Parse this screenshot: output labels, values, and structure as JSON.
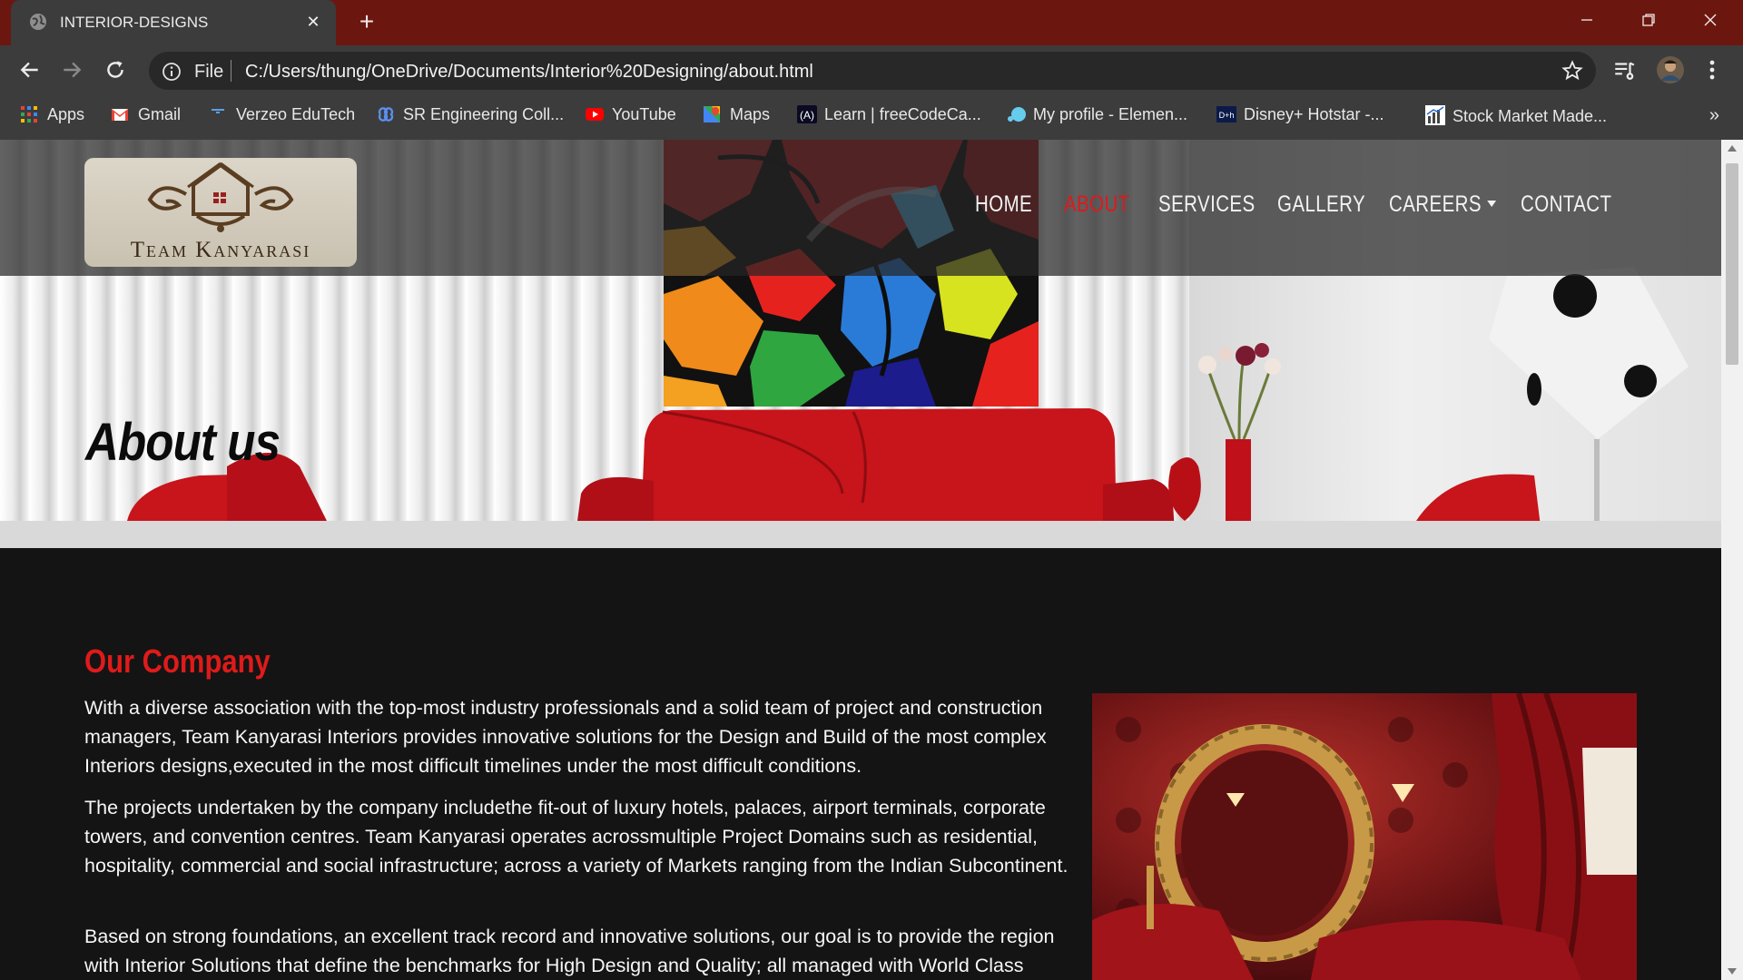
{
  "browser": {
    "tab_title": "INTERIOR-DESIGNS",
    "url_scheme": "File",
    "url": "C:/Users/thung/OneDrive/Documents/Interior%20Designing/about.html",
    "bookmarks": [
      {
        "label": "Apps",
        "icon": "apps-grid-icon"
      },
      {
        "label": "Gmail",
        "icon": "gmail-icon"
      },
      {
        "label": "Verzeo EduTech",
        "icon": "verzeo-icon"
      },
      {
        "label": "SR Engineering Coll...",
        "icon": "sr-engineering-icon"
      },
      {
        "label": "YouTube",
        "icon": "youtube-icon"
      },
      {
        "label": "Maps",
        "icon": "maps-icon"
      },
      {
        "label": "Learn | freeCodeCa...",
        "icon": "freecodecamp-icon"
      },
      {
        "label": "My profile - Elemen...",
        "icon": "elementor-icon"
      },
      {
        "label": "Disney+ Hotstar -...",
        "icon": "hotstar-icon"
      },
      {
        "label": "Stock Market Made...",
        "icon": "stock-market-icon"
      }
    ],
    "bookmarks_overflow": "»"
  },
  "site": {
    "logo_text": "Team Kanyarasi",
    "nav": [
      {
        "label": "HOME",
        "active": false
      },
      {
        "label": "ABOUT",
        "active": true
      },
      {
        "label": "SERVICES",
        "active": false
      },
      {
        "label": "GALLERY",
        "active": false
      },
      {
        "label": "CAREERS",
        "active": false,
        "dropdown": true
      },
      {
        "label": "CONTACT",
        "active": false
      }
    ],
    "hero_title": "About us",
    "section_title": "Our Company",
    "paragraphs": [
      "With a diverse association with the top-most industry professionals and a solid team of project and construction managers, Team Kanyarasi Interiors provides innovative solutions for the Design and Build of the most complex Interiors designs,executed in the most difficult timelines under the most difficult conditions.",
      "The projects undertaken by the company includethe fit-out of luxury hotels, palaces, airport terminals, corporate towers, and convention centres. Team Kanyarasi operates acrossmultiple Project Domains such as residential, hospitality, commercial and social infrastructure; across a variety of Markets ranging from the Indian Subcontinent.",
      "Based on strong foundations, an excellent track record and innovative solutions, our goal is to provide the region with Interior Solutions that define the benchmarks for High Design and Quality; all managed with World Class"
    ]
  },
  "colors": {
    "accent_red": "#e01a1a",
    "tabstrip": "#6b1710",
    "toolbar": "#3c3c3c",
    "page_bg": "#141414"
  }
}
